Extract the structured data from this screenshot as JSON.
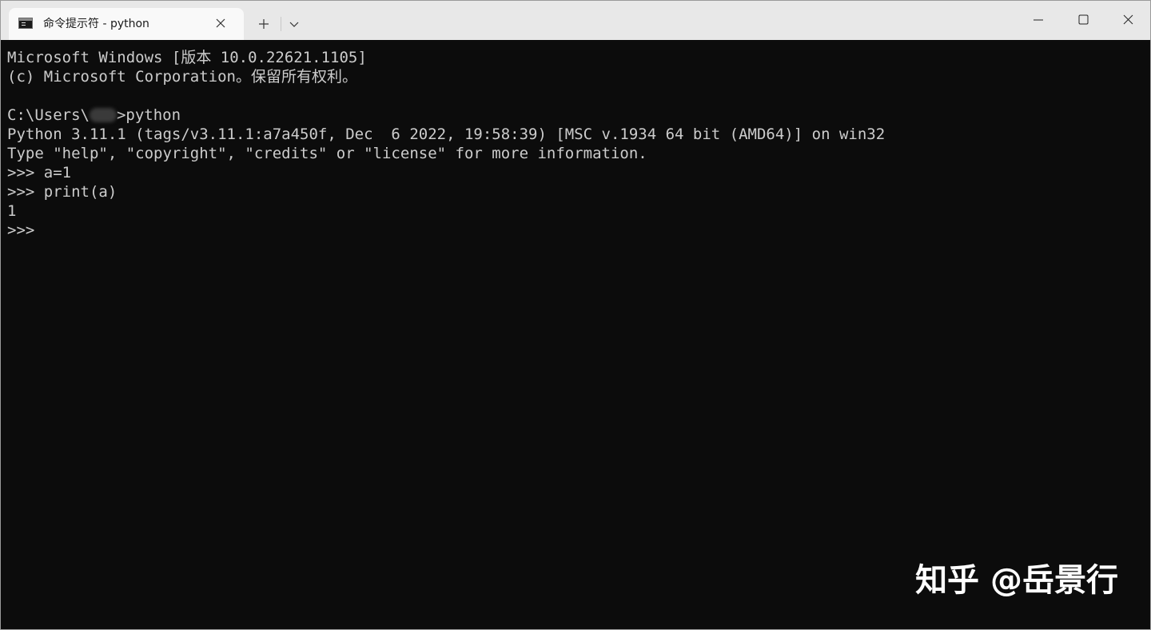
{
  "window": {
    "tab_title": "命令提示符 - python",
    "icons": {
      "tab": "cmd-console-icon",
      "close_tab": "close-icon",
      "new_tab": "plus-icon",
      "dropdown": "chevron-down-icon",
      "minimize": "minimize-icon",
      "maximize": "maximize-icon",
      "close_window": "close-icon"
    }
  },
  "terminal": {
    "line1": "Microsoft Windows [版本 10.0.22621.1105]",
    "line2": "(c) Microsoft Corporation。保留所有权利。",
    "prompt_path": "C:\\Users\\",
    "prompt_command": ">python",
    "line4": "Python 3.11.1 (tags/v3.11.1:a7a450f, Dec  6 2022, 19:58:39) [MSC v.1934 64 bit (AMD64)] on win32",
    "line5": "Type \"help\", \"copyright\", \"credits\" or \"license\" for more information.",
    "line6": ">>> a=1",
    "line7": ">>> print(a)",
    "line8": "1",
    "line9": ">>>"
  },
  "watermark": "知乎 @岳景行",
  "colors": {
    "terminal_bg": "#0c0c0c",
    "terminal_text": "#cccccc",
    "titlebar_bg": "#e8e8e8",
    "tab_bg": "#f9f9f9"
  }
}
